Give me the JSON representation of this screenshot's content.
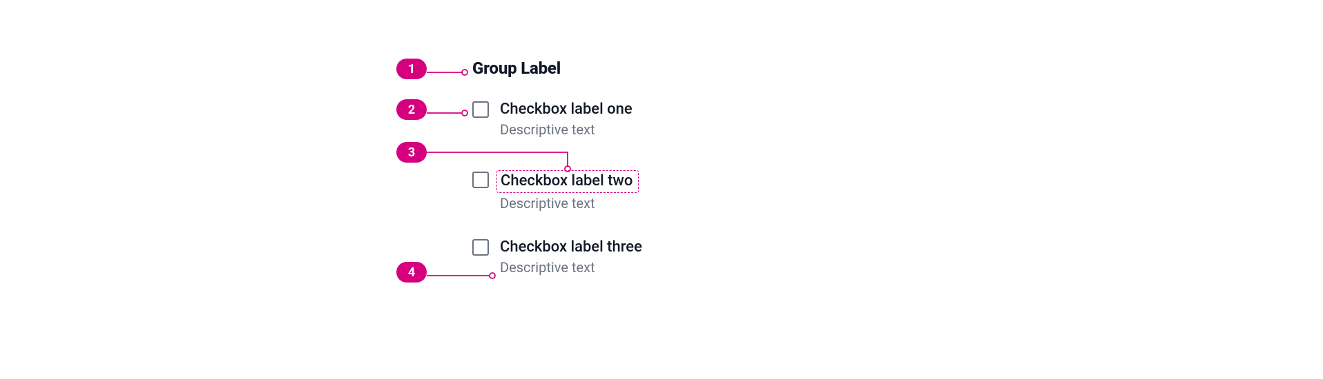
{
  "annotations": {
    "badge1": "1",
    "badge2": "2",
    "badge3": "3",
    "badge4": "4"
  },
  "group_label": "Group Label",
  "checkboxes": [
    {
      "label": "Checkbox label one",
      "description": "Descriptive text"
    },
    {
      "label": "Checkbox label two",
      "description": "Descriptive text"
    },
    {
      "label": "Checkbox label three",
      "description": "Descriptive text"
    }
  ],
  "colors": {
    "accent": "#d6007f",
    "text_primary": "#121826",
    "text_secondary": "#6b7280",
    "checkbox_border": "#6b7280"
  }
}
